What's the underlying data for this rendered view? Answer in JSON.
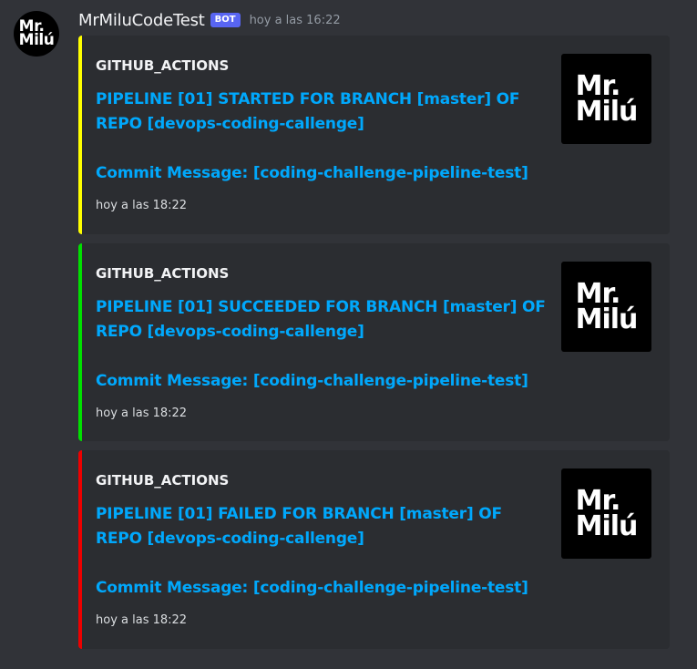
{
  "message": {
    "avatar_logo": [
      "Mr.",
      "Milú"
    ],
    "username": "MrMiluCodeTest",
    "bot_tag": "BOT",
    "timestamp": "hoy a las 16:22"
  },
  "embeds": [
    {
      "color": "#ffff00",
      "author": "GITHUB_ACTIONS",
      "title": "PIPELINE [01] STARTED FOR BRANCH [master] OF REPO [devops-coding-callenge]",
      "description": "Commit Message: [coding-challenge-pipeline-test]",
      "footer": "hoy a las 18:22",
      "thumb_logo": [
        "Mr.",
        "Milú"
      ]
    },
    {
      "color": "#00e000",
      "author": "GITHUB_ACTIONS",
      "title": "PIPELINE [01] SUCCEEDED FOR BRANCH [master] OF REPO [devops-coding-callenge]",
      "description": "Commit Message: [coding-challenge-pipeline-test]",
      "footer": "hoy a las 18:22",
      "thumb_logo": [
        "Mr.",
        "Milú"
      ]
    },
    {
      "color": "#ee0000",
      "author": "GITHUB_ACTIONS",
      "title": "PIPELINE [01] FAILED FOR BRANCH [master] OF REPO [devops-coding-callenge]",
      "description": "Commit Message: [coding-challenge-pipeline-test]",
      "footer": "hoy a las 18:22",
      "thumb_logo": [
        "Mr.",
        "Milú"
      ]
    }
  ]
}
